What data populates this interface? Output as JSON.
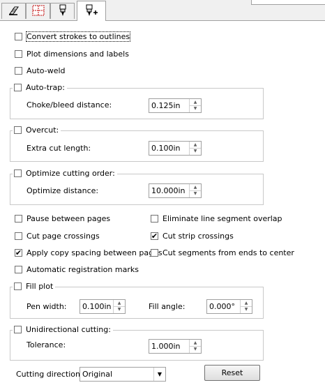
{
  "tabs": [
    {
      "icon": "page-setup-icon",
      "active": false
    },
    {
      "icon": "tile-grid-icon",
      "active": false
    },
    {
      "icon": "cutter-icon",
      "active": false
    },
    {
      "icon": "cutter-plus-icon",
      "active": true
    }
  ],
  "options": {
    "convert_strokes": {
      "label": "Convert strokes to outlines",
      "checked": false
    },
    "plot_dimensions": {
      "label": "Plot dimensions and labels",
      "checked": false
    },
    "auto_weld": {
      "label": "Auto-weld",
      "checked": false
    }
  },
  "auto_trap": {
    "label": "Auto-trap:",
    "checked": false,
    "field_label": "Choke/bleed distance:",
    "value": "0.125in"
  },
  "overcut": {
    "label": "Overcut:",
    "checked": false,
    "field_label": "Extra cut length:",
    "value": "0.100in"
  },
  "optimize": {
    "label": "Optimize cutting order:",
    "checked": false,
    "field_label": "Optimize distance:",
    "value": "10.000in"
  },
  "grid_options": {
    "pause_between_pages": {
      "label": "Pause between pages",
      "checked": false
    },
    "eliminate_overlap": {
      "label": "Eliminate line segment overlap",
      "checked": false
    },
    "cut_page_crossings": {
      "label": "Cut page crossings",
      "checked": false
    },
    "cut_strip_crossings": {
      "label": "Cut strip crossings",
      "checked": true
    },
    "apply_copy_spacing": {
      "label": "Apply copy spacing between pages",
      "checked": true
    },
    "cut_from_ends": {
      "label": "Cut segments from ends to center",
      "checked": false
    },
    "auto_registration": {
      "label": "Automatic registration marks",
      "checked": false
    }
  },
  "fill_plot": {
    "label": "Fill plot",
    "checked": false,
    "pen_width_label": "Pen width:",
    "pen_width": "0.100in",
    "fill_angle_label": "Fill angle:",
    "fill_angle": "0.000°"
  },
  "unidirectional": {
    "label": "Unidirectional cutting:",
    "checked": false,
    "tolerance_label": "Tolerance:",
    "tolerance": "1.000in"
  },
  "cutting_direction": {
    "label": "Cutting direction:",
    "value": "Original"
  },
  "reset_label": "Reset",
  "check_glyph": "✔"
}
